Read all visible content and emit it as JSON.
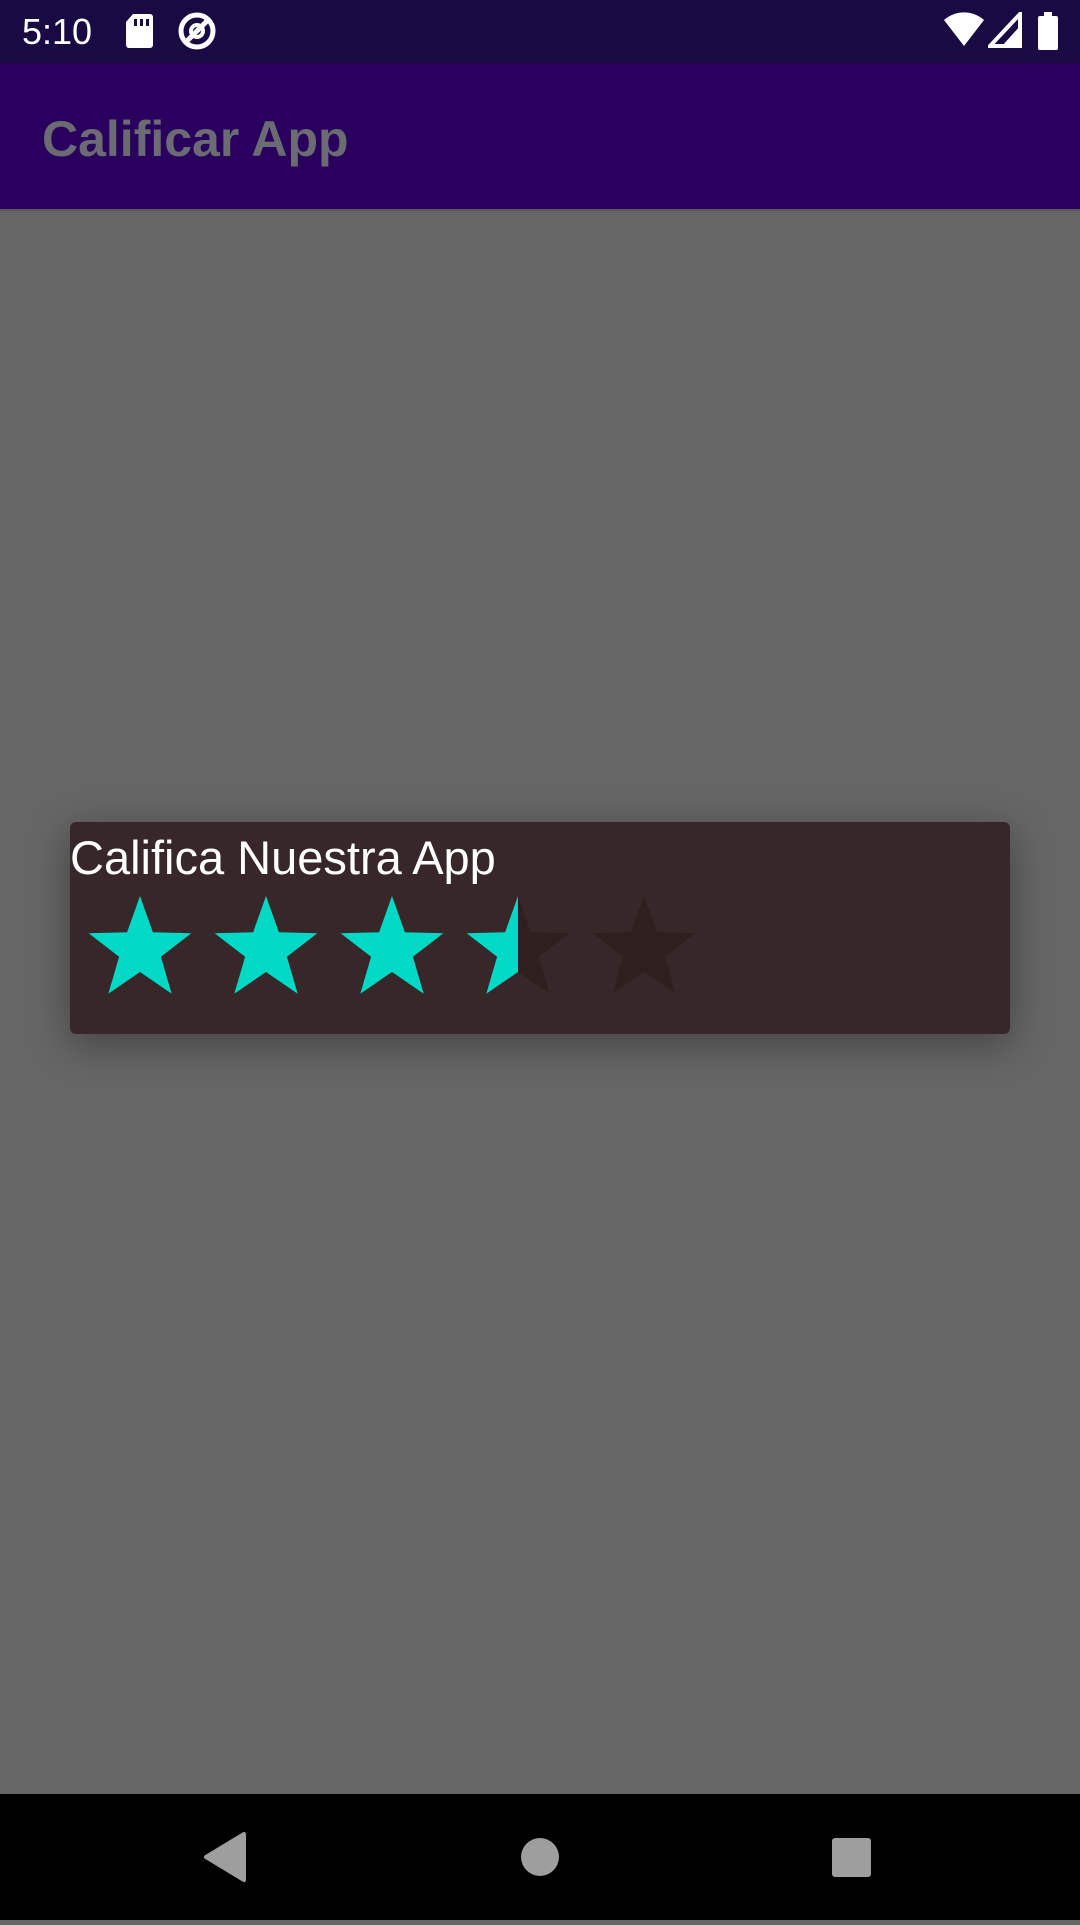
{
  "status_bar": {
    "time": "5:10",
    "icons": [
      "sd-card-icon",
      "data-saver-icon",
      "wifi-icon",
      "signal-icon",
      "battery-icon"
    ]
  },
  "app_bar": {
    "title": "Calificar App"
  },
  "dialog": {
    "title": "Califica Nuestra App",
    "rating": {
      "value": 3.5,
      "max": 5,
      "filled_color": "#00d9c6",
      "empty_color": "#2f2020"
    }
  },
  "nav_bar": {
    "buttons": [
      "back-icon",
      "home-icon",
      "recents-icon"
    ]
  },
  "colors": {
    "status_bar": "#1a0a44",
    "app_bar": "#2a005e",
    "scrim_background": "#666666",
    "dialog_background": "#372728"
  }
}
